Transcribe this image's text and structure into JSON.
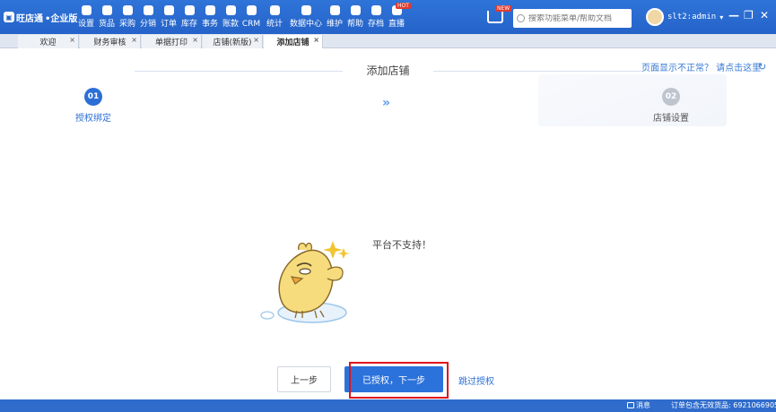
{
  "app": {
    "logo": "旺店通",
    "edition": "•企业版"
  },
  "menu": [
    {
      "label": "设置",
      "icon": "gear-icon"
    },
    {
      "label": "货品",
      "icon": "box-icon"
    },
    {
      "label": "采购",
      "icon": "purchase-icon"
    },
    {
      "label": "分销",
      "icon": "distribution-icon"
    },
    {
      "label": "订单",
      "icon": "order-icon"
    },
    {
      "label": "库存",
      "icon": "inventory-icon"
    },
    {
      "label": "事务",
      "icon": "task-icon"
    },
    {
      "label": "账款",
      "icon": "account-icon"
    },
    {
      "label": "CRM",
      "icon": "crm-icon"
    },
    {
      "label": "统计",
      "icon": "statistics-icon"
    },
    {
      "label": "数据中心",
      "icon": "data-center-icon"
    },
    {
      "label": "维护",
      "icon": "maintenance-icon"
    },
    {
      "label": "帮助",
      "icon": "help-icon"
    },
    {
      "label": "存档",
      "icon": "archive-icon"
    },
    {
      "label": "直播",
      "icon": "live-icon"
    }
  ],
  "badges": {
    "hot": "HOT",
    "new": "NEW"
  },
  "search": {
    "placeholder": "搜索功能菜单/帮助文档"
  },
  "user": {
    "name": "slt2:admin"
  },
  "window": {
    "minimize": "—",
    "restore": "❐",
    "close": "✕"
  },
  "tabs": [
    {
      "label": "欢迎",
      "close": "×"
    },
    {
      "label": "财务审核",
      "close": "×"
    },
    {
      "label": "单据打印",
      "close": "×"
    },
    {
      "label": "店铺(新版)",
      "close": "×"
    },
    {
      "label": "添加店铺",
      "close": "×"
    }
  ],
  "page": {
    "title": "添加店铺",
    "help_link": "页面显示不正常？ 请点击这里",
    "help_icon": "↻",
    "steps": [
      {
        "number": "01",
        "label": "授权绑定"
      },
      {
        "number": "02",
        "label": "店铺设置"
      }
    ],
    "step_arrow": "»",
    "empty_message": "平台不支持！",
    "buttons": {
      "prev": "上一步",
      "next": "已授权，下一步",
      "skip": "跳过授权"
    }
  },
  "statusbar": {
    "message_label": "消息",
    "ticker": "订单包含无效货品: 6921066905"
  }
}
